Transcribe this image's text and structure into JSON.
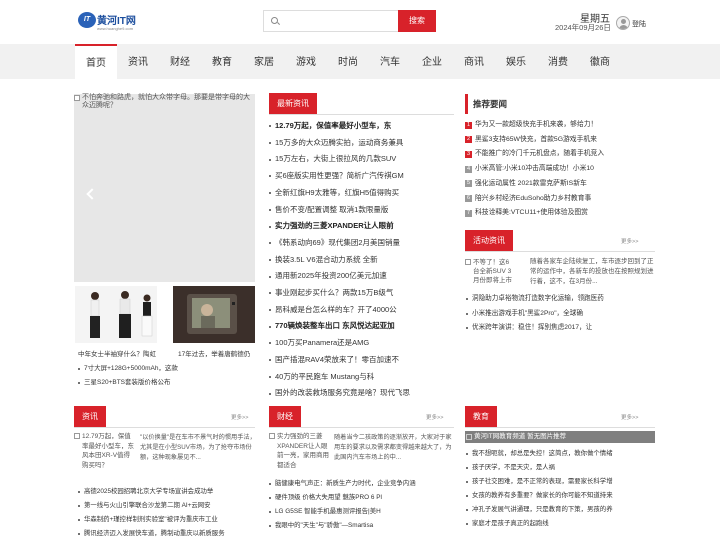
{
  "header": {
    "logo_badge": "IT",
    "logo_name": "黄河IT网",
    "logo_url": "www.huanghe9.com",
    "search_placeholder": "",
    "search_button": "搜索",
    "weekday": "星期五",
    "date": "2024年09月26日",
    "login": "登陆"
  },
  "nav": [
    "首页",
    "资讯",
    "财经",
    "教育",
    "家居",
    "游戏",
    "时尚",
    "汽车",
    "企业",
    "商讯",
    "娱乐",
    "消费",
    "徽商"
  ],
  "slider": {
    "caption": "不怕奔驰和路虎，就怕大众带字母。那要是带字母的大众迈腾呢？",
    "thumb1_label": "中年女士半袖穿什么？陶虹",
    "thumb2_label": "17年过去，举着唐鹤德仍",
    "list": [
      "7寸大屏+128G+5000mAh，这款",
      "三星S20+BTS套装版价格公布"
    ]
  },
  "latest": {
    "title": "最新资讯",
    "items": [
      {
        "text": "12.79万起，保值率最好小型车，东",
        "bold": true
      },
      {
        "text": "15万多的大众迈腾实拍，运动商务兼具",
        "bold": false
      },
      {
        "text": "15万左右，大街上很拉风的几款SUV",
        "bold": false
      },
      {
        "text": "买6座版实用性更强？简析广汽传祺GM",
        "bold": false
      },
      {
        "text": "全新红旗H9太雅等，红旗H5值得购买",
        "bold": false
      },
      {
        "text": "售价不变/配置调整 取消1款限量版",
        "bold": false
      },
      {
        "text": "实力强劲的三菱XPANDER让人眼前",
        "bold": true
      },
      {
        "text": "《韩系动向69》现代集团2月美国销量",
        "bold": false
      },
      {
        "text": "换装3.5L V6混合动力系统 全新",
        "bold": false
      },
      {
        "text": "通用新2025年投资200亿美元加速",
        "bold": false
      },
      {
        "text": "事业刚起步买什么？两款15万B级气",
        "bold": false
      },
      {
        "text": "昂科威是台怎么样的车？开了4000公",
        "bold": false
      },
      {
        "text": "770辆焕装整车出口 东风悦达起亚加",
        "bold": true
      },
      {
        "text": "100万买Panamera还是AMG",
        "bold": false
      },
      {
        "text": "国产插混RAV4荣放来了！零百加速不",
        "bold": false
      },
      {
        "text": "40万的平民跑车 Mustang与科",
        "bold": false
      },
      {
        "text": "国外的改装救场服务究竟是啥？现代飞思",
        "bold": false
      }
    ]
  },
  "recommend": {
    "title": "推荐要闻",
    "items": [
      {
        "num": "1",
        "text": "华为又一款超级快充手机来袭，够给力！"
      },
      {
        "num": "2",
        "text": "黑鲨3支持65W快充，首款5G游戏手机来"
      },
      {
        "num": "3",
        "text": "不能推广的冷门千元机盘点，随着手机竞入"
      },
      {
        "num": "4",
        "text": "小米高管:小米10冲击高端成功！小米10"
      },
      {
        "num": "5",
        "text": "强化运动属性 2021款雷克萨斯IS新车"
      },
      {
        "num": "6",
        "text": "陪兴乡村经济EduSoho助力乡村教育事"
      },
      {
        "num": "7",
        "text": "科技诠释美:VTCU11+使用体验及图赏"
      }
    ]
  },
  "activity": {
    "title": "活动资讯",
    "more": "更多>>",
    "img_alt": "不等了！这6台全新SUV 3月份即将上市",
    "desc": "随着各家车企陆续复工，车市逐步回到了正常的运作中，各新车的投放也在按照规划进行着，这不，在3月份...",
    "items": [
      "洞隐助力卓裕物流打造数字化运输，领跑医药",
      "小米推出游戏手机\"黑鲨2Pro\"，全球确",
      "优米跨年演讲：稳住！挥别焦虑2017，让"
    ]
  },
  "news_module": {
    "title": "资讯",
    "more": "更多>>",
    "img_alt": "12.79万起，保值率最好小型车，东风本田XR-V值得购买吗？",
    "desc": "\"以价换量\"是在车市不景气时的惯用手法，尤其是在小型SUV市场，为了抢夺市场份额，这种现象屡见不...",
    "items": [
      "高徳2025校园招聘北京大学专场宣讲会成功举",
      "第一线与火山引擎联合沙龙第二期 AI+云网安",
      "华森制药+瑾控样制剂实验室\"被评为重庆市工业",
      "腾讯经济迈入发展快车道，腾制动重庆以新质服务"
    ]
  },
  "finance_module": {
    "title": "财经",
    "more": "更多>>",
    "img_alt": "实力强劲的三菱XPANDER让人眼前一亮，家用商用都适合",
    "desc": "随着当今二孩政策的逐渐放开，大家对于家用车的要求以及需求都变得越来越大了，为此国内汽车市场上的中...",
    "items": [
      "脑健康电气声正：新质生产力时代，企业竞争内涵",
      "硬件顶级 价格大失用望 魅族PRO 6 Pl",
      "LG G5SE 智能手机最惠测评报告|美H",
      "我眼中的\"天生\"与\"骄傲\"—Smartisa"
    ]
  },
  "edu_module": {
    "title": "教育",
    "more": "更多>>",
    "banner": "黄河IT网教育频道 暂无图片推荐",
    "items": [
      "我不想呃就，却总是失控！这简点，教你做个情绪",
      "孩子厌学，不是天灾，是人祸",
      "孩子社交困难，是不正常的表现，需要家长科学增",
      "女孩的教养有多重要？做家长的你可能不知道持来",
      "冲孔子发展气讲通理，只是教育的下策，男孩的养",
      "家庭才是孩子真正的起跑线"
    ]
  }
}
